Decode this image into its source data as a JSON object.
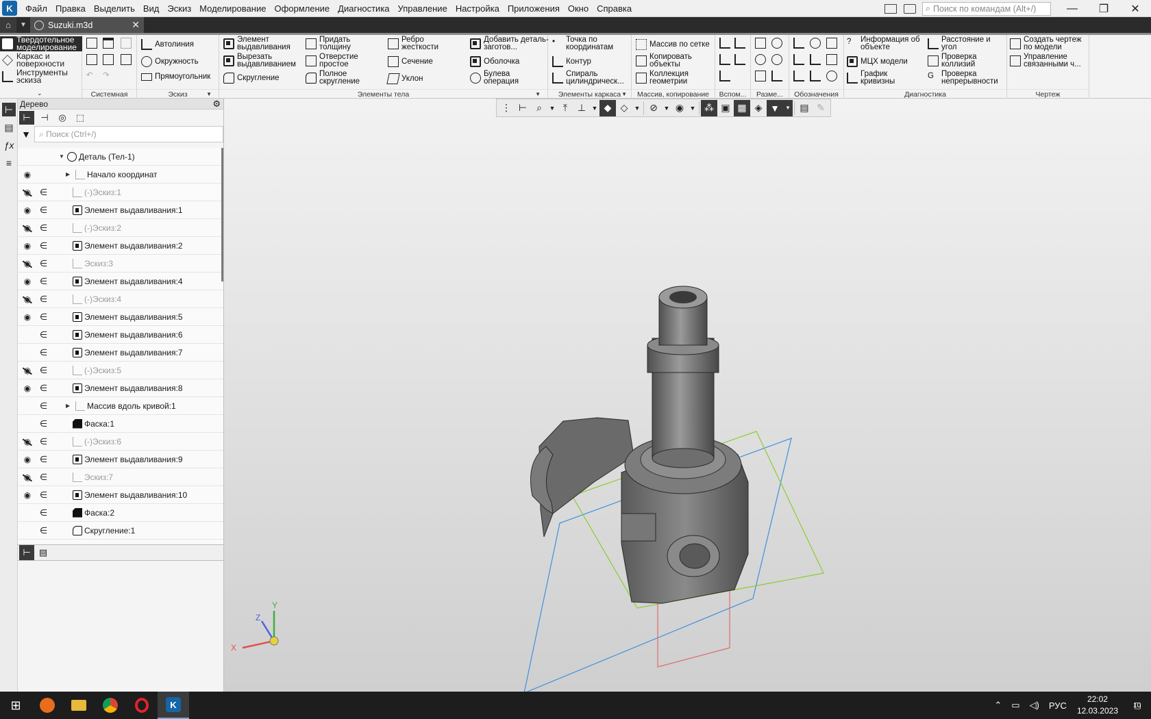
{
  "menu": {
    "items": [
      "Файл",
      "Правка",
      "Выделить",
      "Вид",
      "Эскиз",
      "Моделирование",
      "Оформление",
      "Диагностика",
      "Управление",
      "Настройка",
      "Приложения",
      "Окно",
      "Справка"
    ],
    "search_placeholder": "Поиск по командам (Alt+/)"
  },
  "tabs": {
    "document": "Suzuki.m3d"
  },
  "ribbon": {
    "modes": [
      "Твердотельное моделирование",
      "Каркас и поверхности",
      "Инструменты эскиза"
    ],
    "system_label": "Системная",
    "sketch_label": "Эскиз",
    "sketch_buttons": [
      "Автолиния",
      "Окружность",
      "Прямоугольник"
    ],
    "body_label": "Элементы тела",
    "body_buttons": [
      "Элемент выдавливания",
      "Вырезать выдавливанием",
      "Скругление",
      "Придать толщину",
      "Отверстие простое",
      "Полное скругление",
      "Ребро жесткости",
      "Сечение",
      "Уклон",
      "Добавить деталь-заготов...",
      "Оболочка",
      "Булева операция"
    ],
    "frame_label": "Элементы каркаса",
    "frame_buttons": [
      "Точка по координатам",
      "Контур",
      "Спираль цилиндрическ..."
    ],
    "array_label": "Массив, копирование",
    "array_buttons": [
      "Массив по сетке",
      "Копировать объекты",
      "Коллекция геометрии"
    ],
    "aux_label": "Вспом...",
    "dim_label": "Разме...",
    "notation_label": "Обозначения",
    "diag_label": "Диагностика",
    "diag_buttons": [
      "Информация об объекте",
      "МЦХ модели",
      "График кривизны",
      "Расстояние и угол",
      "Проверка коллизий",
      "Проверка непрерывности"
    ],
    "drawing_label": "Чертеж",
    "drawing_buttons": [
      "Создать чертеж по модели",
      "Управление связанными ч..."
    ]
  },
  "tree": {
    "title": "Дерево",
    "search_placeholder": "Поиск (Ctrl+/)",
    "items": [
      {
        "label": "Деталь (Тел-1)",
        "icon": "part-icon",
        "eye": "none",
        "inc": false,
        "dim": false
      },
      {
        "label": "Начало координат",
        "icon": "origin-icon",
        "eye": "visible",
        "inc": false,
        "dim": false
      },
      {
        "label": "(-)Эскиз:1",
        "icon": "sketch-icon",
        "eye": "hidden",
        "inc": true,
        "dim": true
      },
      {
        "label": "Элемент выдавливания:1",
        "icon": "extrude-icon",
        "eye": "visible",
        "inc": true,
        "dim": false
      },
      {
        "label": "(-)Эскиз:2",
        "icon": "sketch-icon",
        "eye": "hidden",
        "inc": true,
        "dim": true
      },
      {
        "label": "Элемент выдавливания:2",
        "icon": "extrude-icon",
        "eye": "visible",
        "inc": true,
        "dim": false
      },
      {
        "label": "Эскиз:3",
        "icon": "sketch-icon",
        "eye": "hidden",
        "inc": true,
        "dim": true
      },
      {
        "label": "Элемент выдавливания:4",
        "icon": "extrude-icon",
        "eye": "visible",
        "inc": true,
        "dim": false
      },
      {
        "label": "(-)Эскиз:4",
        "icon": "sketch-icon",
        "eye": "hidden",
        "inc": true,
        "dim": true
      },
      {
        "label": "Элемент выдавливания:5",
        "icon": "extrude-icon",
        "eye": "visible",
        "inc": true,
        "dim": false
      },
      {
        "label": "Элемент выдавливания:6",
        "icon": "extrude-icon",
        "eye": "none",
        "inc": true,
        "dim": false
      },
      {
        "label": "Элемент выдавливания:7",
        "icon": "extrude-icon",
        "eye": "none",
        "inc": true,
        "dim": false
      },
      {
        "label": "(-)Эскиз:5",
        "icon": "sketch-icon",
        "eye": "hidden",
        "inc": true,
        "dim": true
      },
      {
        "label": "Элемент выдавливания:8",
        "icon": "extrude-icon",
        "eye": "visible",
        "inc": true,
        "dim": false
      },
      {
        "label": "Массив вдоль кривой:1",
        "icon": "array-curve-icon",
        "eye": "none",
        "inc": true,
        "dim": false
      },
      {
        "label": "Фаска:1",
        "icon": "chamfer-icon",
        "eye": "none",
        "inc": true,
        "dim": false
      },
      {
        "label": "(-)Эскиз:6",
        "icon": "sketch-icon",
        "eye": "hidden",
        "inc": true,
        "dim": true
      },
      {
        "label": "Элемент выдавливания:9",
        "icon": "extrude-icon",
        "eye": "visible",
        "inc": true,
        "dim": false
      },
      {
        "label": "Эскиз:7",
        "icon": "sketch-icon",
        "eye": "hidden",
        "inc": true,
        "dim": true
      },
      {
        "label": "Элемент выдавливания:10",
        "icon": "extrude-icon",
        "eye": "visible",
        "inc": true,
        "dim": false
      },
      {
        "label": "Фаска:2",
        "icon": "chamfer-icon",
        "eye": "none",
        "inc": true,
        "dim": false
      },
      {
        "label": "Скругление:1",
        "icon": "fillet-icon",
        "eye": "none",
        "inc": true,
        "dim": false
      }
    ]
  },
  "viewport": {
    "axis_labels": {
      "x": "X",
      "y": "Y",
      "z": "Z"
    },
    "colors": {
      "x_axis": "#e05050",
      "y_axis": "#3fae3f",
      "z_axis": "#4a66d8",
      "plane_xy": "#3d8fe0",
      "plane_zx": "#8acc30",
      "plane_zy": "#e06a6a",
      "model": "#707070"
    }
  },
  "taskbar": {
    "time": "22:02",
    "date": "12.03.2023",
    "lang": "РУС",
    "notifications": "10"
  }
}
